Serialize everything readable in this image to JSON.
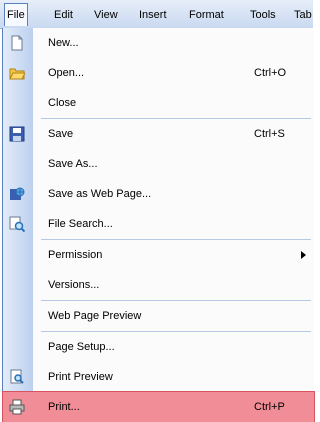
{
  "menubar": {
    "items": [
      "File",
      "Edit",
      "View",
      "Insert",
      "Format",
      "Tools",
      "Tab"
    ]
  },
  "menu": {
    "items": [
      {
        "label": "New...",
        "icon": "new-document-icon"
      },
      {
        "label": "Open...",
        "shortcut": "Ctrl+O",
        "icon": "open-folder-icon"
      },
      {
        "label": "Close"
      },
      {
        "label": "Save",
        "shortcut": "Ctrl+S",
        "icon": "save-floppy-icon"
      },
      {
        "label": "Save As..."
      },
      {
        "label": "Save as Web Page...",
        "icon": "web-page-icon"
      },
      {
        "label": "File Search...",
        "icon": "file-search-icon"
      },
      {
        "label": "Permission",
        "submenu": true
      },
      {
        "label": "Versions..."
      },
      {
        "label": "Web Page Preview"
      },
      {
        "label": "Page Setup..."
      },
      {
        "label": "Print Preview",
        "icon": "print-preview-icon"
      },
      {
        "label": "Print...",
        "shortcut": "Ctrl+P",
        "icon": "printer-icon",
        "highlighted": true
      }
    ]
  },
  "colors": {
    "highlight": "#f08d96",
    "gutter": "#bcd0ef",
    "menubar": "#c9d9f1"
  }
}
